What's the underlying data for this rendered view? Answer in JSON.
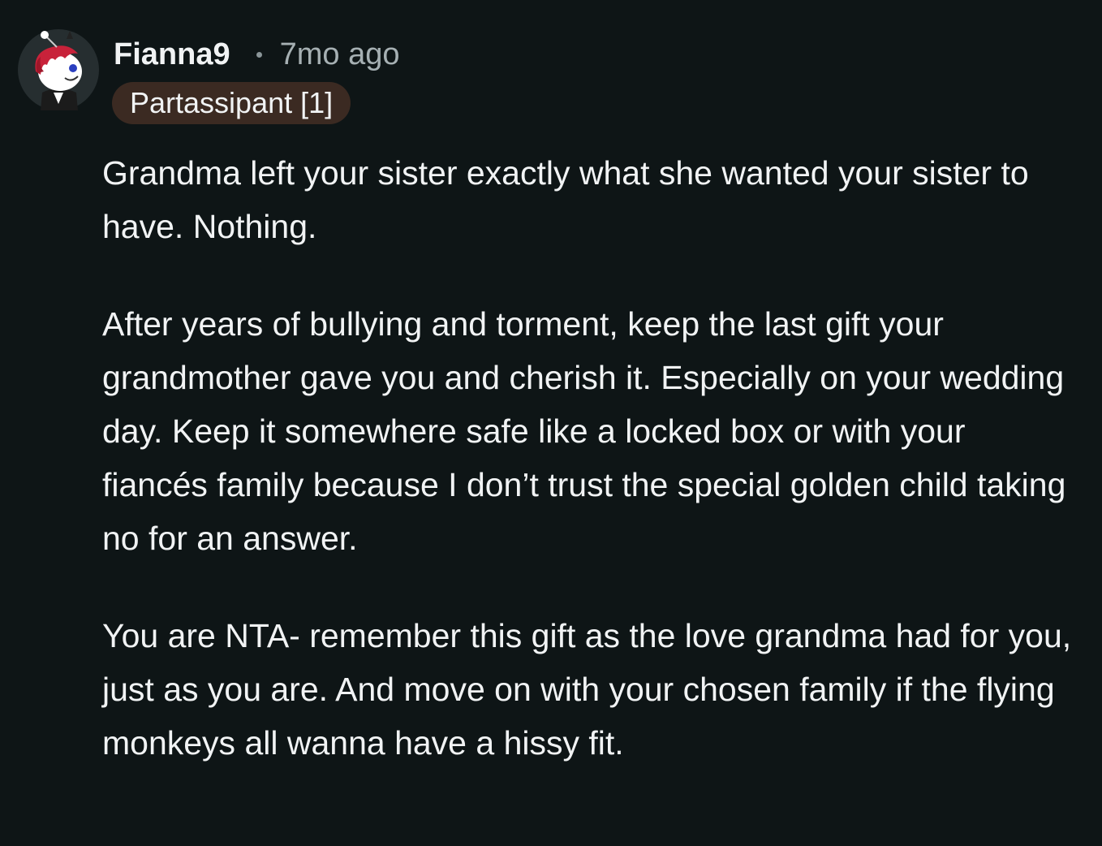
{
  "comment": {
    "author": {
      "username": "Fianna9",
      "avatar_icon": "avatar-icon"
    },
    "timestamp": "7mo ago",
    "flair": "Partassipant [1]",
    "paragraphs": [
      "Grandma left your sister exactly what she wanted your sister to have. Nothing.",
      "After years of bullying and torment, keep the last gift your grandmother gave you and cherish it. Especially on your wedding day. Keep it somewhere safe like a locked box or with your fiancés family because I don’t trust the special golden child taking no for an answer.",
      "You are NTA- remember this gift as the love grandma had for you, just as you are. And move on with your chosen family if the flying monkeys all wanna have a hissy fit."
    ]
  },
  "colors": {
    "background": "#0e1516",
    "text": "#f1f3f4",
    "muted": "#a6b0b3",
    "flair_bg": "#3b2a22"
  }
}
